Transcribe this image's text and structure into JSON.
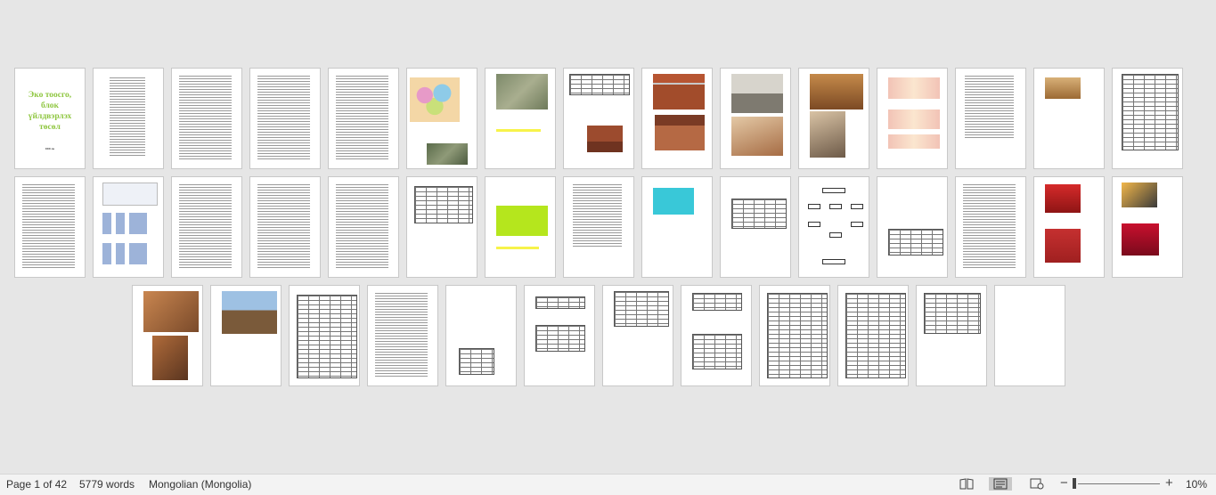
{
  "cover": {
    "title_lines": [
      "Эко тоосго,",
      "блок",
      "үйлдвэрлэх",
      "төсөл"
    ],
    "subtitle": "ХХХ он"
  },
  "status_bar": {
    "page_info": "Page 1 of 42",
    "word_count": "5779 words",
    "language": "Mongolian (Mongolia)",
    "zoom_minus": "−",
    "zoom_plus": "+",
    "zoom_level": "10%",
    "zoom_fraction": 0.1
  },
  "view_icons": [
    "read-mode-icon",
    "print-layout-icon",
    "web-layout-icon"
  ],
  "colors": {
    "workspace": "#e6e6e6",
    "cover_title": "#8ec63f",
    "highlight_yellow": "#f7f34a",
    "highlight_cyan": "#39c8d8",
    "highlight_green": "#b5e61d"
  }
}
